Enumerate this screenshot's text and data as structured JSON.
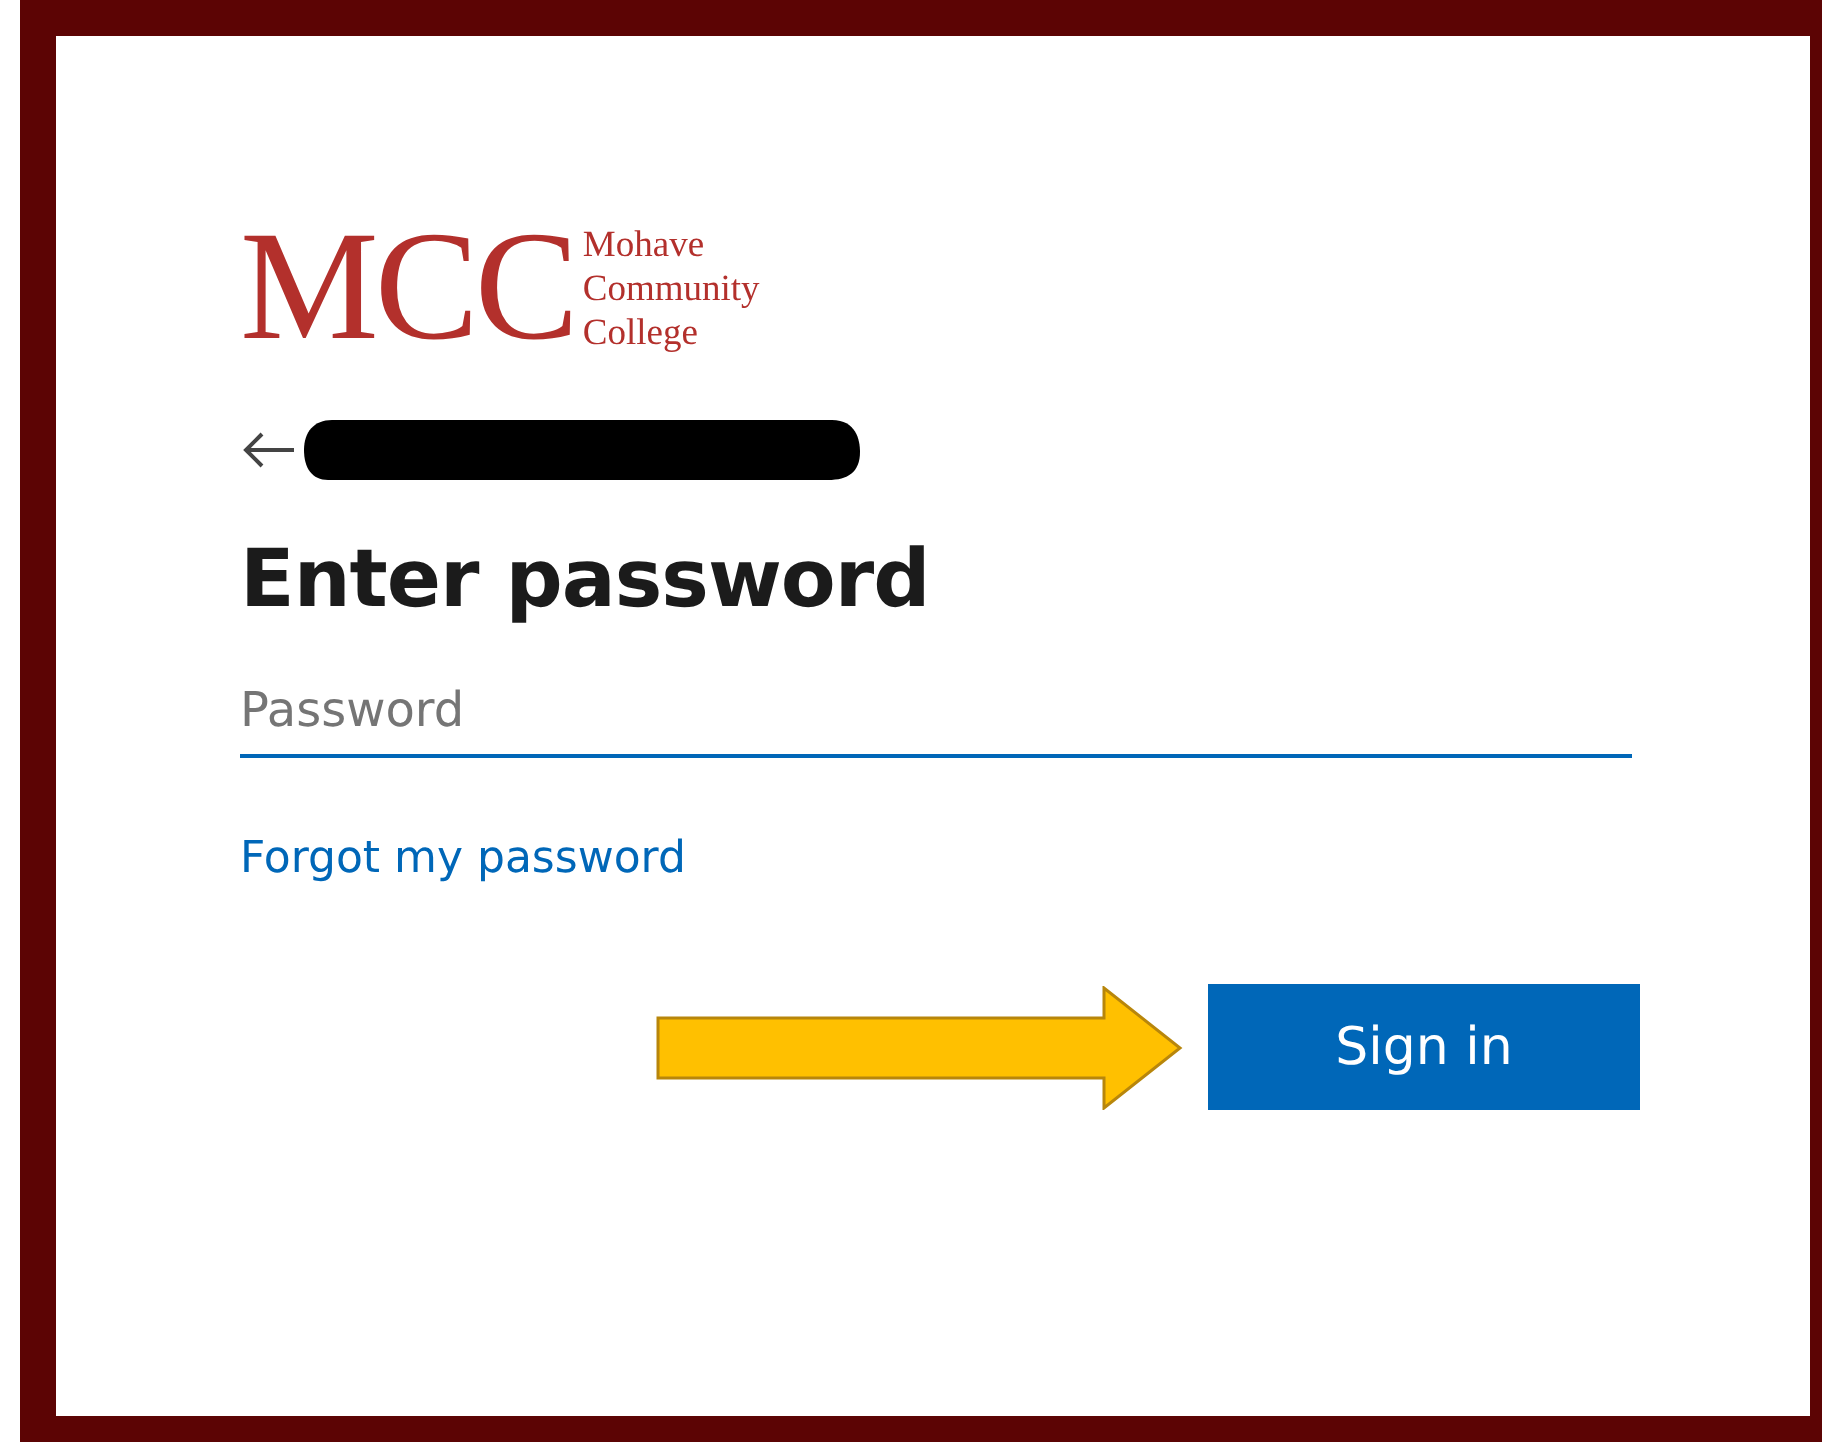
{
  "logo": {
    "mark": "MCC",
    "lines": [
      "Mohave",
      "Community",
      "College"
    ]
  },
  "title": "Enter password",
  "password_field": {
    "placeholder": "Password"
  },
  "forgot_link": "Forgot my password",
  "sign_in_button": "Sign in"
}
